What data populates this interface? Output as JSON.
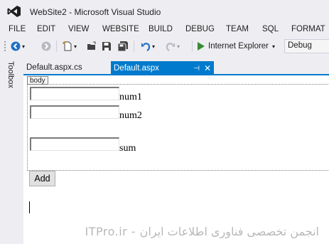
{
  "window": {
    "title": "WebSite2 - Microsoft Visual Studio"
  },
  "menu": [
    "FILE",
    "EDIT",
    "VIEW",
    "WEBSITE",
    "BUILD",
    "DEBUG",
    "TEAM",
    "SQL",
    "FORMAT"
  ],
  "toolbar": {
    "run_target": "Internet Explorer",
    "configuration": "Debug",
    "icons": [
      "back-icon",
      "forward-icon",
      "new-item-icon",
      "open-icon",
      "save-icon",
      "save-all-icon",
      "undo-icon",
      "redo-icon",
      "run-icon"
    ]
  },
  "toolbox": {
    "label": "Toolbox"
  },
  "tabs": [
    {
      "label": "Default.aspx.cs",
      "active": false
    },
    {
      "label": "Default.aspx",
      "active": true
    }
  ],
  "designer": {
    "body_tag": "body",
    "fields": [
      {
        "label": "num1",
        "value": ""
      },
      {
        "label": "num2",
        "value": ""
      },
      {
        "label": "sum",
        "value": ""
      }
    ],
    "button_label": "Add"
  },
  "watermark": "ITPro.ir - انجمن تخصصی فناوری اطلاعات ایران",
  "colors": {
    "accent": "#007acc",
    "chrome": "#eeeef2",
    "vs_purple": "#68217a"
  }
}
